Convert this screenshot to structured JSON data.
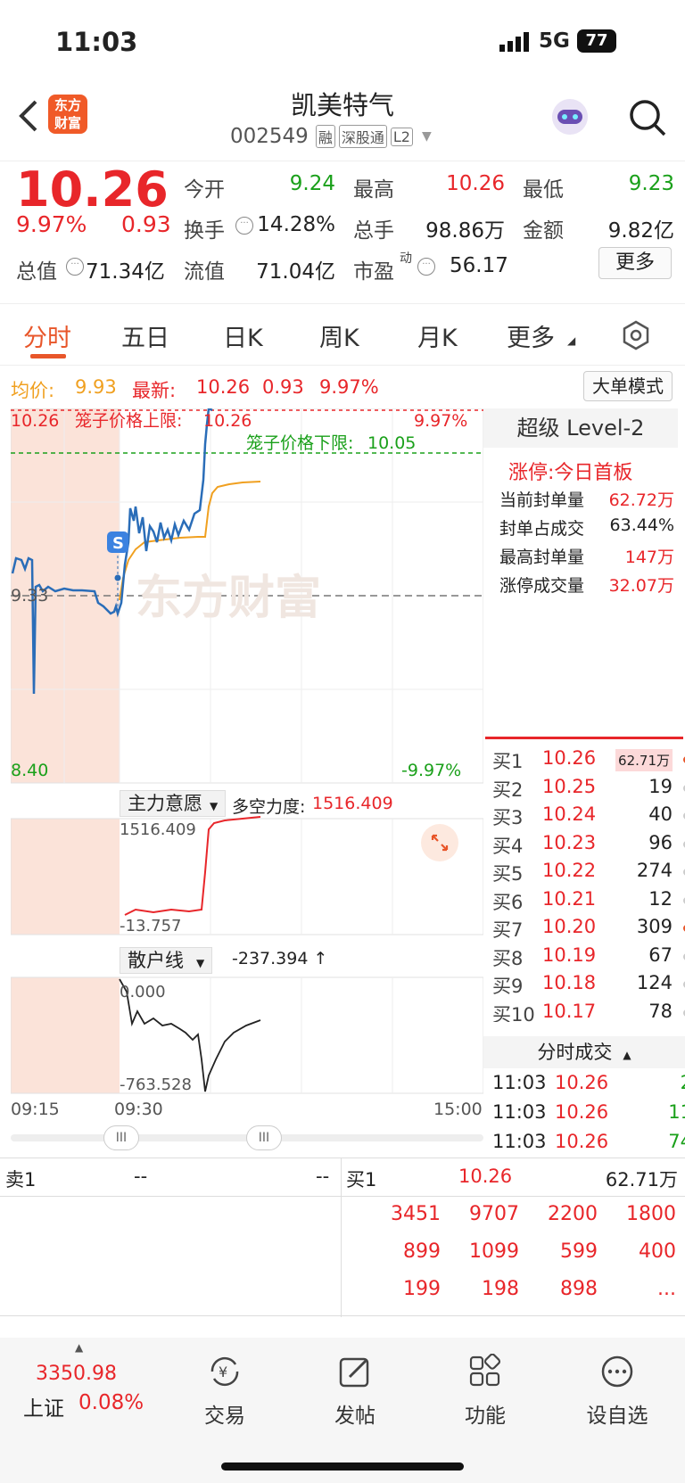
{
  "status": {
    "time": "11:03",
    "network": "5G",
    "battery": "77"
  },
  "header": {
    "logo": "东方\n财富",
    "name": "凯美特气",
    "code": "002549",
    "tags": [
      "融",
      "深股通",
      "L2"
    ]
  },
  "quote": {
    "price": "10.26",
    "pct": "9.97%",
    "chg": "0.93",
    "fields": [
      {
        "label": "今开",
        "value": "9.24",
        "color": "#1aa01a"
      },
      {
        "label": "最高",
        "value": "10.26",
        "color": "#e8262a"
      },
      {
        "label": "最低",
        "value": "9.23",
        "color": "#1aa01a"
      },
      {
        "label": "换手",
        "value": "14.28%",
        "color": "#222"
      },
      {
        "label": "总手",
        "value": "98.86万",
        "color": "#222"
      },
      {
        "label": "金额",
        "value": "9.82亿",
        "color": "#222"
      },
      {
        "label": "总值",
        "value": "71.34亿",
        "color": "#222"
      },
      {
        "label": "流值",
        "value": "71.04亿",
        "color": "#222"
      },
      {
        "label": "市盈",
        "value": "56.17",
        "color": "#222"
      }
    ],
    "pe_sup": "动",
    "more_button": "更多"
  },
  "tabs": [
    "分时",
    "五日",
    "日K",
    "周K",
    "月K",
    "更多"
  ],
  "infobar": {
    "avg_label": "均价:",
    "avg": "9.93",
    "last_label": "最新:",
    "last": "10.26",
    "chg": "0.93",
    "pct": "9.97%",
    "mode_button": "大单模式"
  },
  "main_chart": {
    "y_top": "10.26",
    "y_mid": "9.33",
    "y_bottom": "8.40",
    "pct_top": "9.97%",
    "pct_bottom": "-9.97%",
    "upper_limit_label": "笼子价格上限:",
    "upper_limit": "10.26",
    "lower_limit_label": "笼子价格下限:",
    "lower_limit": "10.05",
    "s_marker": "S",
    "watermark": "东方财富"
  },
  "indicator1": {
    "name": "主力意愿",
    "label": "多空力度:",
    "value": "1516.409",
    "top": "1516.409",
    "bottom": "-13.757"
  },
  "indicator2": {
    "name": "散户线",
    "value": "-237.394 ↑",
    "top": "0.000",
    "bottom": "-763.528"
  },
  "time_axis": [
    "09:15",
    "09:30",
    "15:00"
  ],
  "level2": {
    "title": "超级 Level-2",
    "limit_up": "涨停:今日首板",
    "rows": [
      {
        "label": "当前封单量",
        "value": "62.72万"
      },
      {
        "label": "封单占成交",
        "value": "63.44%"
      },
      {
        "label": "最高封单量",
        "value": "147万"
      },
      {
        "label": "涨停成交量",
        "value": "32.07万"
      }
    ]
  },
  "orderbook": [
    {
      "label": "买1",
      "price": "10.26",
      "vol": "62.71万",
      "dot": "#e8562a"
    },
    {
      "label": "买2",
      "price": "10.25",
      "vol": "19",
      "dot": "#ccc"
    },
    {
      "label": "买3",
      "price": "10.24",
      "vol": "40",
      "dot": "#ccc"
    },
    {
      "label": "买4",
      "price": "10.23",
      "vol": "96",
      "dot": "#ccc"
    },
    {
      "label": "买5",
      "price": "10.22",
      "vol": "274",
      "dot": "#ccc"
    },
    {
      "label": "买6",
      "price": "10.21",
      "vol": "12",
      "dot": "#ccc"
    },
    {
      "label": "买7",
      "price": "10.20",
      "vol": "309",
      "dot": "#e8562a"
    },
    {
      "label": "买8",
      "price": "10.19",
      "vol": "67",
      "dot": "#ccc"
    },
    {
      "label": "买9",
      "price": "10.18",
      "vol": "124",
      "dot": "#ccc"
    },
    {
      "label": "买10",
      "price": "10.17",
      "vol": "78",
      "dot": "#ccc"
    }
  ],
  "trades_title": "分时成交",
  "trades": [
    {
      "time": "11:03",
      "price": "10.26",
      "vol": "2"
    },
    {
      "time": "11:03",
      "price": "10.26",
      "vol": "11"
    },
    {
      "time": "11:03",
      "price": "10.26",
      "vol": "74"
    }
  ],
  "bottom": {
    "sell_label": "卖1",
    "sell_price": "--",
    "sell_vol": "--",
    "buy_label": "买1",
    "buy_price": "10.26",
    "buy_vol": "62.71万",
    "queue": [
      [
        "3451",
        "9707",
        "2200",
        "1800"
      ],
      [
        "899",
        "1099",
        "599",
        "400"
      ],
      [
        "199",
        "198",
        "898",
        "..."
      ]
    ]
  },
  "tabbar": {
    "index_value": "3350.98",
    "index_name": "上证",
    "index_pct": "0.08%",
    "items": [
      {
        "label": "交易",
        "icon": "yuan-refresh-icon"
      },
      {
        "label": "发帖",
        "icon": "pencil-edit-icon"
      },
      {
        "label": "功能",
        "icon": "grid-apps-icon"
      },
      {
        "label": "设自选",
        "icon": "more-dots-icon"
      }
    ]
  }
}
